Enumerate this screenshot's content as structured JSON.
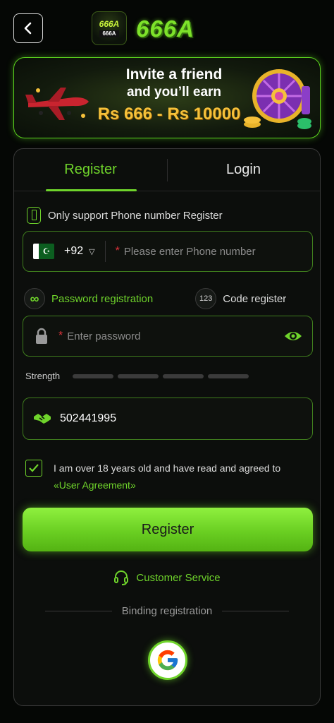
{
  "header": {
    "logo_small_top": "666A",
    "logo_small_bottom": "666A",
    "logo_text": "666A"
  },
  "banner": {
    "line1": "Invite a friend",
    "line2": "and you’ll earn",
    "line3": "Rs 666 - Rs 10000"
  },
  "tabs": [
    {
      "label": "Register",
      "active": true
    },
    {
      "label": "Login",
      "active": false
    }
  ],
  "register": {
    "note": "Only support Phone number Register",
    "phone": {
      "country_code": "+92",
      "required_mark": "*",
      "placeholder": "Please enter Phone number"
    },
    "modes": {
      "password": "Password registration",
      "code_badge": "123",
      "code": "Code register"
    },
    "password": {
      "required_mark": "*",
      "placeholder": "Enter password"
    },
    "strength_label": "Strength",
    "strength_level": 0,
    "invite_code": "502441995",
    "agreement": {
      "text": "I am over 18 years old and have read and agreed to",
      "link": "«User Agreement»",
      "checked": true
    },
    "submit": "Register",
    "customer_service": "Customer Service",
    "binding": "Binding registration"
  },
  "colors": {
    "accent": "#6fd42b",
    "required": "#e2333b",
    "gold": "#f5c13a"
  }
}
